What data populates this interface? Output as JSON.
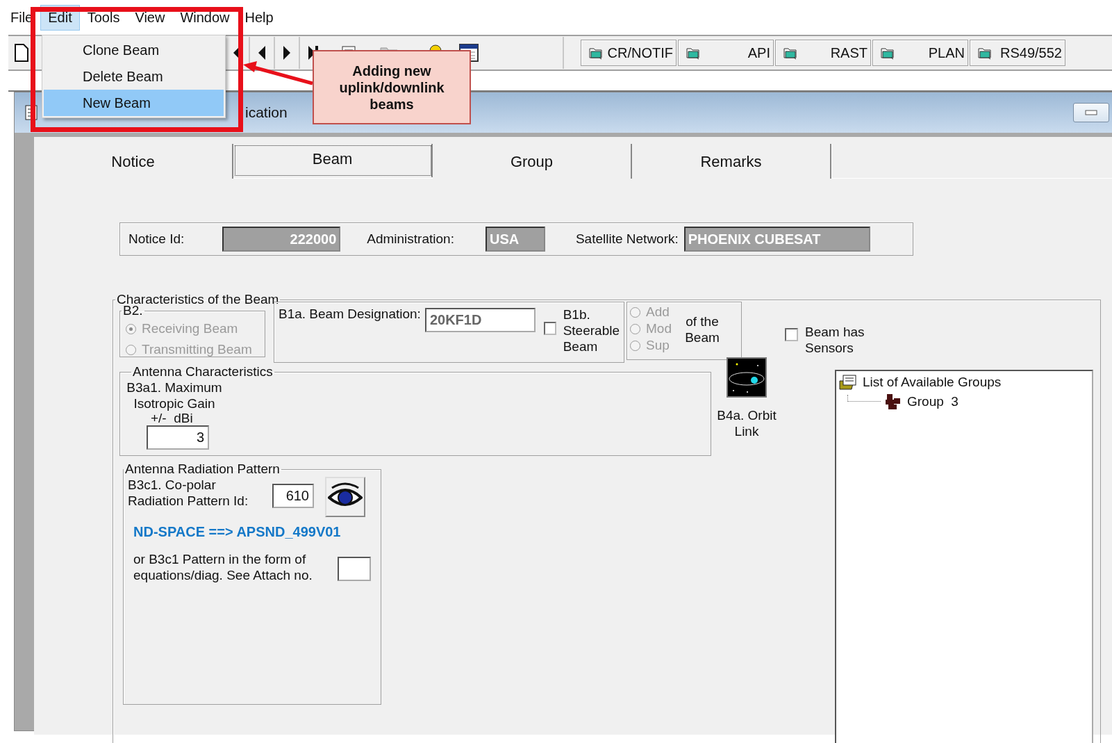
{
  "menu_bar": [
    {
      "label": "File",
      "selected": false
    },
    {
      "label": "Edit",
      "selected": true
    },
    {
      "label": "Tools",
      "selected": false
    },
    {
      "label": "View",
      "selected": false
    },
    {
      "label": "Window",
      "selected": false
    },
    {
      "label": "Help",
      "selected": false
    }
  ],
  "edit_menu": [
    {
      "label": "Clone Beam",
      "selected": false
    },
    {
      "label": "Delete Beam",
      "selected": false
    },
    {
      "label": "New Beam",
      "selected": true
    }
  ],
  "callout": {
    "text": "Adding new uplink/downlink beams"
  },
  "toolbar_buttons": [
    {
      "label": "CR/NOTIF"
    },
    {
      "label": "API"
    },
    {
      "label": "RAST"
    },
    {
      "label": "PLAN"
    },
    {
      "label": "RS49/552"
    }
  ],
  "window": {
    "title": "ication"
  },
  "tabs": [
    {
      "label": "Notice",
      "selected": false
    },
    {
      "label": "Beam",
      "selected": true
    },
    {
      "label": "Group",
      "selected": false
    },
    {
      "label": "Remarks",
      "selected": false
    }
  ],
  "notice": {
    "notice_id_label": "Notice Id:",
    "notice_id": "222000",
    "administration_label": "Administration:",
    "administration": "USA",
    "satellite_network_label": "Satellite Network:",
    "satellite_network": "PHOENIX CUBESAT"
  },
  "beam": {
    "title": "Characteristics of the Beam",
    "b2": {
      "title": "B2.",
      "disabled": true,
      "options": [
        {
          "label": "Receiving Beam",
          "selected": true
        },
        {
          "label": "Transmitting Beam",
          "selected": false
        }
      ]
    },
    "designation": {
      "label": "B1a. Beam Designation:",
      "value": "20KF1D"
    },
    "steerable": {
      "label": "B1b. Steerable Beam",
      "checked": false
    },
    "action": {
      "label": "of the Beam",
      "disabled": true,
      "options": [
        {
          "label": "Add",
          "selected": false
        },
        {
          "label": "Mod",
          "selected": false
        },
        {
          "label": "Sup",
          "selected": false
        }
      ]
    },
    "sensors": {
      "label": "Beam has Sensors",
      "checked": false
    },
    "antenna": {
      "title": "Antenna Characteristics",
      "gain_label": "B3a1. Maximum Isotropic Gain",
      "unit": "+/-  dBi",
      "gain": "3"
    },
    "orbit_link": {
      "label": "B4a. Orbit Link"
    },
    "pattern": {
      "title": "Antenna Radiation Pattern",
      "id_label": "B3c1. Co-polar Radiation Pattern Id:",
      "id": "610",
      "link": "ND-SPACE ==> APSND_499V01",
      "attach_label": "or B3c1 Pattern in the form of equations/diag. See Attach no."
    },
    "groups": {
      "label": "List of Available Groups",
      "children": [
        {
          "label": "Group  3"
        }
      ]
    }
  }
}
